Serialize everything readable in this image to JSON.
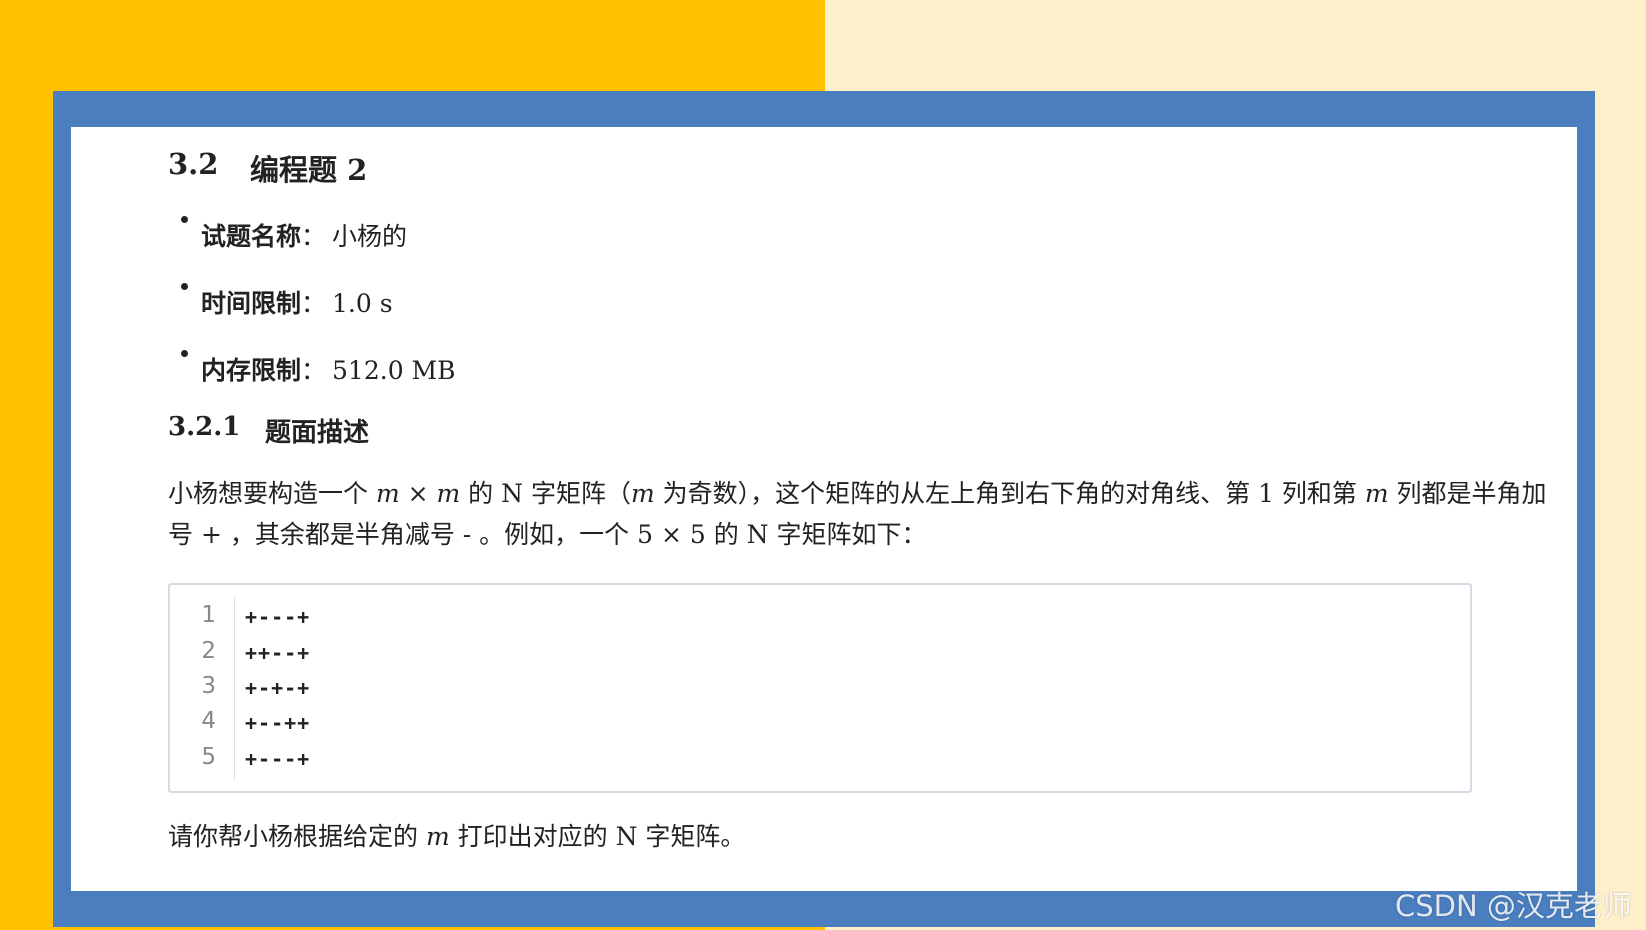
{
  "section": {
    "number": "3.2",
    "title": "编程题 2"
  },
  "info": [
    {
      "key": "试题名称",
      "sep": "：",
      "value": "小杨的"
    },
    {
      "key": "时间限制",
      "sep": "：",
      "value": "1.0 s"
    },
    {
      "key": "内存限制",
      "sep": "：",
      "value": "512.0 MB"
    }
  ],
  "subsection": {
    "number": "3.2.1",
    "title": "题面描述"
  },
  "description": {
    "p1": "小杨想要构造一个 ",
    "m1": "m",
    "times1": " × ",
    "m2": "m",
    "p2": " 的 N 字矩阵（",
    "m3": "m",
    "p3": " 为奇数），这个矩阵的从左上角到右下角的对角线、第 1 列和第 ",
    "m4": "m",
    "p4": " 列都是半角加号 + ，其余都是半角减号 - 。例如，一个 5 × 5 的 N 字矩阵如下："
  },
  "code": {
    "line_numbers": [
      "1",
      "2",
      "3",
      "4",
      "5"
    ],
    "lines": [
      "+---+",
      "++--+",
      "+-+-+",
      "+--++",
      "+---+"
    ]
  },
  "closing": {
    "p1": "请你帮小杨根据给定的 ",
    "m": "m",
    "p2": " 打印出对应的 N 字矩阵。"
  },
  "watermark": "CSDN @汉克老师",
  "colors": {
    "left_bg": "#FFC000",
    "right_bg": "#FFF0CC",
    "frame": "#4A7EBF"
  }
}
